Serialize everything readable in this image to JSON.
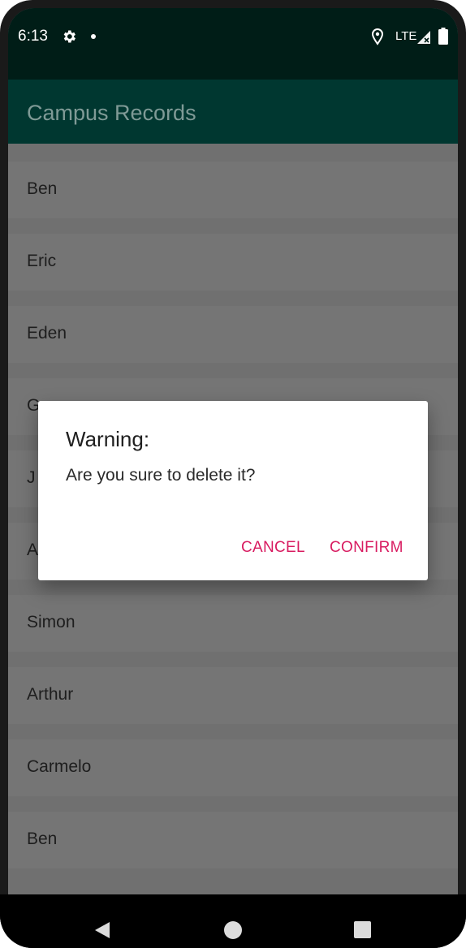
{
  "status_bar": {
    "time": "6:13",
    "network": "LTE",
    "icons": [
      "gear-icon",
      "notification-dot",
      "location-icon",
      "signal-icon",
      "battery-icon"
    ]
  },
  "app_bar": {
    "title": "Campus Records"
  },
  "list": {
    "items": [
      {
        "label": "Ben"
      },
      {
        "label": "Eric"
      },
      {
        "label": "Eden"
      },
      {
        "label": "G"
      },
      {
        "label": "J"
      },
      {
        "label": "A"
      },
      {
        "label": "Simon"
      },
      {
        "label": "Arthur"
      },
      {
        "label": "Carmelo"
      },
      {
        "label": "Ben"
      }
    ]
  },
  "dialog": {
    "title": "Warning:",
    "message": "Are you sure to delete it?",
    "cancel_label": "CANCEL",
    "confirm_label": "CONFIRM"
  },
  "nav_bar": {
    "icons": [
      "back-icon",
      "home-icon",
      "recents-icon"
    ]
  },
  "colors": {
    "status_bar": "#001d17",
    "app_bar": "#003730",
    "accent": "#d81b60"
  }
}
